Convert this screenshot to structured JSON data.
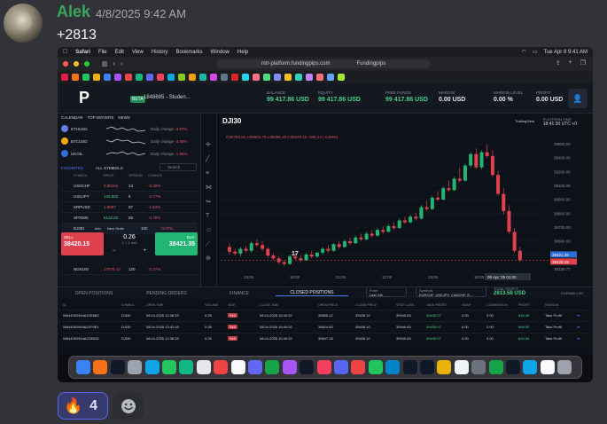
{
  "message": {
    "username": "Alek",
    "timestamp": "4/8/2025 9:42 AM",
    "text": "+2813"
  },
  "reaction": {
    "emoji": "🔥",
    "count": "4"
  },
  "icons": {
    "avatar": "avatar",
    "add_reaction": "smiley-icon"
  },
  "screenshot": {
    "menubar": {
      "app": "Safari",
      "items": [
        "File",
        "Edit",
        "View",
        "History",
        "Bookmarks",
        "Window",
        "Help"
      ],
      "clock": "Tue Apr 8  9:41 AM"
    },
    "browser": {
      "url": "mtr-platform.fundingpips.com",
      "site_title": "Fundingpips"
    },
    "account": {
      "badge": "BETA",
      "name": "1848695 - Studen...",
      "metrics": [
        {
          "label": "BALANCE",
          "value": "99 417.86 USD",
          "style": "green"
        },
        {
          "label": "EQUITY",
          "value": "99 417.86 USD",
          "style": "green"
        },
        {
          "label": "FREE FUNDS",
          "value": "99 417.86 USD",
          "style": "green"
        },
        {
          "label": "MARGIN",
          "value": "0.00 USD",
          "style": "white"
        },
        {
          "label": "MARGIN LEVEL",
          "value": "0.00 %",
          "style": "white"
        },
        {
          "label": "PROFIT",
          "value": "0.00 USD",
          "style": "white"
        }
      ]
    },
    "watchlist": {
      "tabs": [
        "CALENDAR",
        "TOP MOVERS",
        "NEWS"
      ],
      "tickers": [
        {
          "name": "ETHUSD",
          "change_label": "Daily change",
          "change": "-3.87%",
          "color": "#6a7ee8"
        },
        {
          "name": "BTCUSD",
          "change_label": "Daily change",
          "change": "-3.58%",
          "color": "#f2a900"
        },
        {
          "name": "UKOIL",
          "change_label": "Daily change",
          "change": "-1.86%",
          "color": "#2f6fd6"
        }
      ],
      "favorites_tab": "FAVORITES",
      "all_symbols_tab": "ALL SYMBOLS",
      "search_placeholder": "Search",
      "columns": [
        "SYMBOL",
        "PRICE",
        "SPREAD",
        "CHANGE"
      ],
      "rows": [
        {
          "symbol": "USDCHF",
          "price": "0.85184",
          "spread": "13",
          "change": "-0.38%"
        },
        {
          "symbol": "USDJPY",
          "price": "146.583",
          "spread": "5",
          "change": "-0.77%"
        },
        {
          "symbol": "XRPUSD",
          "price": "1.8697",
          "spread": "87",
          "change": "-1.84%"
        },
        {
          "symbol": "SPX500",
          "price": "5132.82",
          "spread": "55",
          "change": "-0.78%"
        },
        {
          "symbol": "DJI30",
          "price": "38420.15",
          "spread": "100",
          "change": "-0.07%"
        }
      ],
      "info_label": "Info",
      "new_order_label": "New Order",
      "sell_label": "SELL",
      "sell_price": "38420.15",
      "buy_label": "BUY",
      "buy_price": "38421.35",
      "quantity": "0.26",
      "quantity_sub": "1 = 1 unit",
      "last_row": {
        "symbol": "NDX100",
        "price": "17575.12",
        "spread": "120",
        "change": "-0.27%"
      }
    },
    "chart": {
      "symbol": "DJI30",
      "ohlc": "O38783.81  H38904.75  L38395.15  C38420.15  -345.14 (-0.89%)",
      "tradingview_label": "TradingView",
      "platform_time_label": "PLATFORM TIME",
      "platform_time": "18:41:30 UTC +0",
      "date_marker": "09 Apr '25  01:00",
      "price_ticks": [
        "39600.00",
        "39400.00",
        "39200.00",
        "39100.00",
        "38900.00",
        "38800.00",
        "38700.00",
        "38600.00",
        "38500.00",
        "38330.77"
      ],
      "sell_tag": "38421.35",
      "buy_tag": "38420.15",
      "time_ticks": [
        "15:00",
        "18:00",
        "21:00",
        "12:00",
        "15:00",
        "18:00",
        "21:00"
      ]
    },
    "chart_data": {
      "type": "candlestick",
      "title": "DJI30",
      "ylim": [
        38330,
        39650
      ],
      "candles": [
        [
          38560,
          38600,
          38480,
          38510
        ],
        [
          38510,
          38540,
          38470,
          38490
        ],
        [
          38490,
          38560,
          38460,
          38540
        ],
        [
          38540,
          38570,
          38500,
          38520
        ],
        [
          38520,
          38620,
          38500,
          38600
        ],
        [
          38600,
          38640,
          38560,
          38580
        ],
        [
          38580,
          38620,
          38520,
          38540
        ],
        [
          38540,
          38560,
          38450,
          38470
        ],
        [
          38470,
          38500,
          38420,
          38440
        ],
        [
          38440,
          38460,
          38380,
          38400
        ],
        [
          38400,
          38420,
          38360,
          38380
        ],
        [
          38380,
          38480,
          38370,
          38460
        ],
        [
          38460,
          38500,
          38420,
          38440
        ],
        [
          38440,
          38470,
          38400,
          38420
        ],
        [
          38420,
          38500,
          38410,
          38480
        ],
        [
          38480,
          38520,
          38440,
          38460
        ],
        [
          38460,
          38510,
          38440,
          38500
        ],
        [
          38500,
          38560,
          38480,
          38540
        ],
        [
          38540,
          38580,
          38500,
          38520
        ],
        [
          38520,
          38600,
          38510,
          38590
        ],
        [
          38590,
          38620,
          38540,
          38560
        ],
        [
          38560,
          38640,
          38550,
          38620
        ],
        [
          38620,
          38660,
          38580,
          38600
        ],
        [
          38600,
          38680,
          38590,
          38660
        ],
        [
          38660,
          38700,
          38620,
          38640
        ],
        [
          38640,
          38720,
          38630,
          38700
        ],
        [
          38700,
          38740,
          38660,
          38680
        ],
        [
          38680,
          38760,
          38670,
          38740
        ],
        [
          38740,
          38780,
          38700,
          38720
        ],
        [
          38720,
          38800,
          38710,
          38780
        ],
        [
          38780,
          38820,
          38740,
          38760
        ],
        [
          38760,
          38860,
          38750,
          38840
        ],
        [
          38840,
          38880,
          38800,
          38820
        ],
        [
          38820,
          38900,
          38810,
          38880
        ],
        [
          38880,
          38920,
          38840,
          38860
        ],
        [
          38860,
          39000,
          38850,
          38980
        ],
        [
          38980,
          39050,
          38940,
          38960
        ],
        [
          38960,
          39100,
          38950,
          39080
        ],
        [
          39080,
          39150,
          39040,
          39060
        ],
        [
          39060,
          39200,
          39050,
          39180
        ],
        [
          39180,
          39260,
          39140,
          39160
        ],
        [
          39160,
          39300,
          39150,
          39280
        ],
        [
          39280,
          39400,
          39240,
          39260
        ],
        [
          39260,
          39440,
          39250,
          39420
        ],
        [
          39420,
          39560,
          39400,
          39540
        ],
        [
          39540,
          39600,
          39380,
          39400
        ],
        [
          39400,
          39580,
          39380,
          39560
        ],
        [
          39560,
          39640,
          39500,
          39520
        ],
        [
          39520,
          39580,
          39300,
          39320
        ],
        [
          39320,
          39360,
          39100,
          39120
        ],
        [
          39120,
          39180,
          38900,
          38940
        ],
        [
          38940,
          39000,
          38700,
          38720
        ],
        [
          38720,
          38760,
          38500,
          38520
        ],
        [
          38520,
          38560,
          38400,
          38420
        ]
      ]
    },
    "bottom_panel": {
      "tabs": [
        "OPEN POSITIONS",
        "PENDING ORDERS",
        "FINANCE",
        "CLOSED POSITIONS"
      ],
      "active_tab": "CLOSED POSITIONS",
      "from_label": "From",
      "from_value": "Last 24h",
      "symbols_label": "Symbols",
      "symbols_value": "EURCHF, USDJPY, CADCHF, E...",
      "total_profit_label": "TOTAL PROFIT",
      "total_profit": "2813.58 USD",
      "expand_label": "EXPAND LIST",
      "columns": [
        "ID",
        "SYMBOL",
        "OPEN TIME",
        "VOLUME",
        "SIDE",
        "CLOSE TIME",
        "OPEN PRICE",
        "CLOSE PRICE",
        "STOP LOSS",
        "TAKE PROFIT",
        "SWAP",
        "COMMISSION",
        "PROFIT",
        "REASON"
      ],
      "rows": [
        {
          "id": "W644092944A21E6B2",
          "symbol": "DJI30",
          "open_time": "08.04.2025 12:38:33",
          "volume": "0.26",
          "side": "Sell",
          "close_time": "08.04.2025 16:40:32",
          "open_price": "39856.12",
          "close_price": "39435.10",
          "stop_loss": "39949.83",
          "take_profit": "39435.07",
          "swap": "0.00",
          "commission": "0.00",
          "profit": "646.36",
          "reason": "Take Profit"
        },
        {
          "id": "W644092944A21F9E1",
          "symbol": "DJI30",
          "open_time": "08.04.2025 13:42:16",
          "volume": "0.26",
          "side": "Sell",
          "close_time": "08.04.2025 16:40:32",
          "open_price": "39824.60",
          "close_price": "39435.10",
          "stop_loss": "39949.83",
          "take_profit": "39435.07",
          "swap": "0.00",
          "commission": "0.00",
          "profit": "565.90",
          "reason": "Take Profit"
        },
        {
          "id": "W644092944A2190D5",
          "symbol": "DJI30",
          "open_time": "08.04.2025 12:38:33",
          "volume": "0.26",
          "side": "Sell",
          "close_time": "08.04.2025 16:40:32",
          "open_price": "39847.18",
          "close_price": "39435.10",
          "stop_loss": "39949.83",
          "take_profit": "39435.07",
          "swap": "0.00",
          "commission": "0.00",
          "profit": "634.56",
          "reason": "Take Profit"
        }
      ]
    },
    "dock_colors": [
      "#3b82f6",
      "#f97316",
      "#111827",
      "#9ca3af",
      "#0ea5e9",
      "#22c55e",
      "#10b981",
      "#e5e7eb",
      "#ef4444",
      "#f8fafc",
      "#6366f1",
      "#16a34a",
      "#a855f7",
      "#111827",
      "#f43f5e",
      "#5865f2",
      "#ef4444",
      "#22c55e",
      "#0284c7",
      "#111827",
      "#0f172a",
      "#eab308",
      "#f1f5f9",
      "#6b7280",
      "#16a34a",
      "#111827",
      "#0ea5e9",
      "#f8fafc",
      "#9ca3af"
    ]
  }
}
